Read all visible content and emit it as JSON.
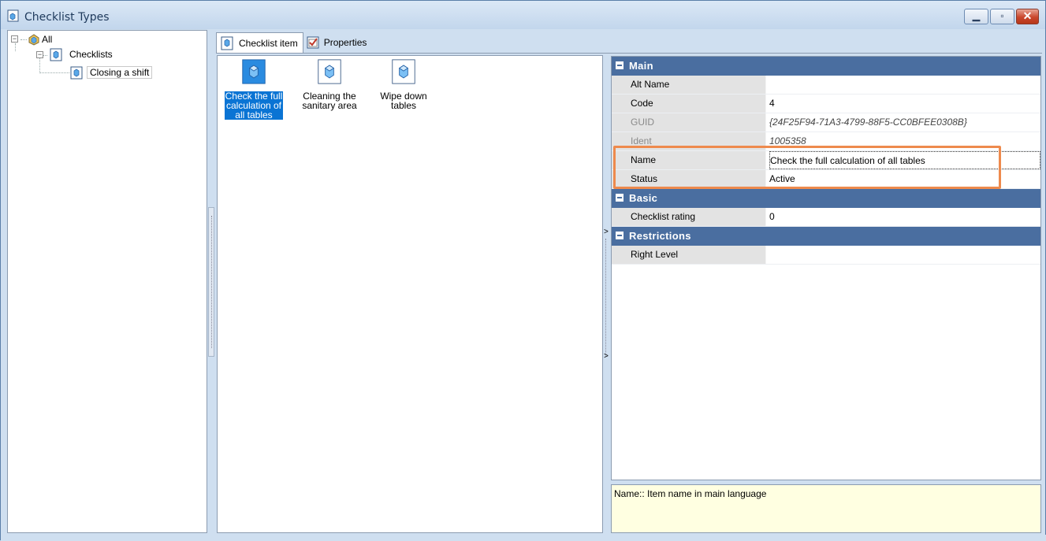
{
  "window": {
    "title": "Checklist Types"
  },
  "tree": {
    "root": "All",
    "child": "Checklists",
    "leaf": "Closing a shift"
  },
  "tabs": [
    {
      "label": "Checklist item"
    },
    {
      "label": "Properties"
    }
  ],
  "items": [
    {
      "line1": "Check the full",
      "line2": "calculation of",
      "line3": "all tables",
      "selected": true
    },
    {
      "line1": "Cleaning the",
      "line2": "sanitary area",
      "line3": "",
      "selected": false
    },
    {
      "line1": "Wipe down",
      "line2": "tables",
      "line3": "",
      "selected": false
    }
  ],
  "properties": {
    "main": {
      "label": "Main",
      "alt_name": {
        "name": "Alt Name",
        "value": ""
      },
      "code": {
        "name": "Code",
        "value": "4"
      },
      "guid": {
        "name": "GUID",
        "value": "{24F25F94-71A3-4799-88F5-CC0BFEE0308B}"
      },
      "ident": {
        "name": "Ident",
        "value": "1005358"
      },
      "name": {
        "name": "Name",
        "value": "Check the full calculation of all tables"
      },
      "status": {
        "name": "Status",
        "value": "Active"
      }
    },
    "basic": {
      "label": "Basic",
      "rating": {
        "name": "Checklist rating",
        "value": "0"
      }
    },
    "restrictions": {
      "label": "Restrictions",
      "right_level": {
        "name": "Right Level",
        "value": ""
      }
    }
  },
  "help": {
    "text": "Name:: Item name in main language"
  },
  "colors": {
    "category": "#4a6ea0",
    "selection": "#0a74d4",
    "highlight": "#ee8a4d",
    "help_bg": "#ffffe1"
  }
}
